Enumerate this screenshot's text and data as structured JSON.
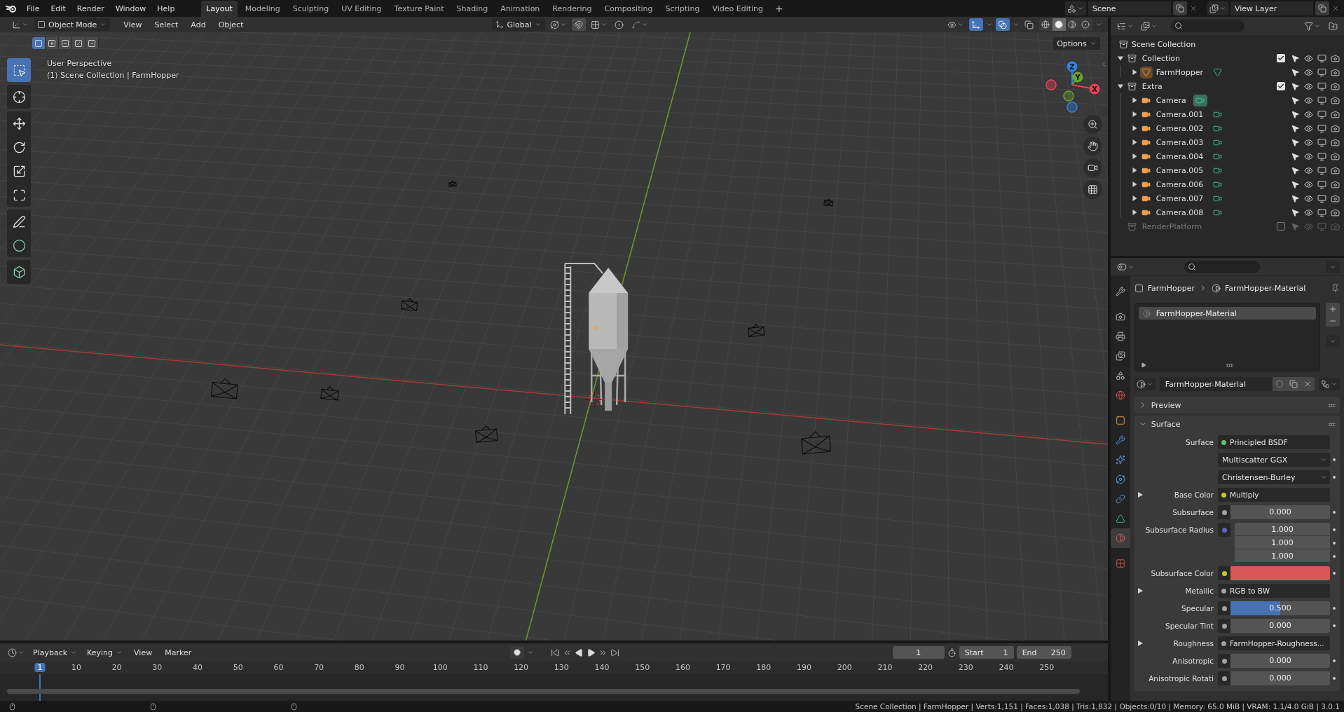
{
  "topbar": {
    "menus": [
      "File",
      "Edit",
      "Render",
      "Window",
      "Help"
    ],
    "workspaces": [
      {
        "label": "Layout",
        "selected": true
      },
      {
        "label": "Modeling",
        "selected": false
      },
      {
        "label": "Sculpting",
        "selected": false
      },
      {
        "label": "UV Editing",
        "selected": false
      },
      {
        "label": "Texture Paint",
        "selected": false
      },
      {
        "label": "Shading",
        "selected": false
      },
      {
        "label": "Animation",
        "selected": false
      },
      {
        "label": "Rendering",
        "selected": false
      },
      {
        "label": "Compositing",
        "selected": false
      },
      {
        "label": "Scripting",
        "selected": false
      },
      {
        "label": "Video Editing",
        "selected": false
      }
    ],
    "add_workspace": "+",
    "scene": "Scene",
    "view_layer": "View Layer"
  },
  "viewport": {
    "mode": "Object Mode",
    "menus": [
      "View",
      "Select",
      "Add",
      "Object"
    ],
    "orientation": "Global",
    "gizmos_on": true,
    "overlays_on": true,
    "xray_on": false,
    "options": "Options",
    "shading": [
      {
        "kind": "wireframe",
        "selected": false
      },
      {
        "kind": "solid",
        "selected": true
      },
      {
        "kind": "material",
        "selected": false
      },
      {
        "kind": "rendered",
        "selected": false
      }
    ],
    "select_modes": [
      {
        "kind": "set",
        "selected": true
      },
      {
        "kind": "extend",
        "selected": false
      },
      {
        "kind": "subtract",
        "selected": false
      },
      {
        "kind": "invert",
        "selected": false
      },
      {
        "kind": "intersect",
        "selected": false
      }
    ],
    "tool_groups": [
      {
        "tools": [
          {
            "kind": "select",
            "selected": true
          }
        ]
      },
      {
        "tools": [
          {
            "kind": "cursor",
            "selected": false
          }
        ]
      },
      {
        "tools": [
          {
            "kind": "move",
            "selected": false
          },
          {
            "kind": "rotate",
            "selected": false
          },
          {
            "kind": "scale",
            "selected": false
          },
          {
            "kind": "transform",
            "selected": false
          }
        ]
      },
      {
        "tools": [
          {
            "kind": "annotate",
            "selected": false
          },
          {
            "kind": "measure",
            "selected": false
          }
        ]
      },
      {
        "tools": [
          {
            "kind": "add_cube",
            "selected": false
          }
        ]
      }
    ],
    "info": [
      "User Perspective",
      "(1) Scene Collection | FarmHopper"
    ],
    "gizmo_axes": [
      {
        "label": "Z"
      },
      {
        "label": "Y"
      },
      {
        "label": "X"
      }
    ]
  },
  "outliner": {
    "root": {
      "name": "Scene Collection",
      "children": [
        {
          "name": "Collection",
          "kind": "collection",
          "expanded": true,
          "checked": true,
          "children": [
            {
              "name": "FarmHopper",
              "kind": "mesh",
              "expanded": false,
              "active": true,
              "data_active": false
            }
          ]
        },
        {
          "name": "Extra",
          "kind": "collection",
          "expanded": true,
          "checked": true,
          "children": [
            {
              "name": "Camera",
              "kind": "camera",
              "expanded": false,
              "active": false,
              "data_active": true
            },
            {
              "name": "Camera.001",
              "kind": "camera",
              "expanded": false,
              "active": false,
              "data_active": false
            },
            {
              "name": "Camera.002",
              "kind": "camera",
              "expanded": false,
              "active": false,
              "data_active": false
            },
            {
              "name": "Camera.003",
              "kind": "camera",
              "expanded": false,
              "active": false,
              "data_active": false
            },
            {
              "name": "Camera.004",
              "kind": "camera",
              "expanded": false,
              "active": false,
              "data_active": false
            },
            {
              "name": "Camera.005",
              "kind": "camera",
              "expanded": false,
              "active": false,
              "data_active": false
            },
            {
              "name": "Camera.006",
              "kind": "camera",
              "expanded": false,
              "active": false,
              "data_active": false
            },
            {
              "name": "Camera.007",
              "kind": "camera",
              "expanded": false,
              "active": false,
              "data_active": false
            },
            {
              "name": "Camera.008",
              "kind": "camera",
              "expanded": false,
              "active": false,
              "data_active": false
            }
          ]
        },
        {
          "name": "RenderPlatform",
          "kind": "collection",
          "checked": false
        }
      ]
    }
  },
  "properties": {
    "tab_groups": [
      {
        "tabs": [
          {
            "kind": "tool",
            "selected": false
          }
        ]
      },
      {
        "tabs": [
          {
            "kind": "render",
            "selected": false
          },
          {
            "kind": "output",
            "selected": false
          },
          {
            "kind": "view_layer",
            "selected": false
          },
          {
            "kind": "scene",
            "selected": false
          },
          {
            "kind": "world",
            "selected": false
          }
        ]
      },
      {
        "tabs": [
          {
            "kind": "object",
            "selected": false
          },
          {
            "kind": "modifiers",
            "selected": false
          },
          {
            "kind": "particles",
            "selected": false
          },
          {
            "kind": "physics",
            "selected": false
          },
          {
            "kind": "constraints",
            "selected": false
          },
          {
            "kind": "data",
            "selected": false
          },
          {
            "kind": "material",
            "selected": true
          }
        ]
      },
      {
        "tabs": [
          {
            "kind": "texture",
            "selected": false
          }
        ]
      }
    ],
    "breadcrumb": [
      "FarmHopper",
      "FarmHopper-Material"
    ],
    "slots": [
      {
        "name": "FarmHopper-Material",
        "selected": true
      }
    ],
    "material": "FarmHopper-Material",
    "panels": [
      {
        "title": "Preview",
        "expanded": false
      },
      {
        "title": "Surface",
        "expanded": true,
        "rows": [
          {
            "kind": "link",
            "label": "Surface",
            "value": "Principled BSDF",
            "socket": {
              "color": "#5fc45f"
            },
            "expandable": false
          },
          {
            "kind": "enum",
            "value": "Multiscatter GGX",
            "expandable": false
          },
          {
            "kind": "enum",
            "value": "Christensen-Burley",
            "expandable": false
          },
          {
            "kind": "link",
            "label": "Base Color",
            "value": "Multiply",
            "socket": {
              "color": "#c7c729"
            },
            "expandable": true
          },
          {
            "kind": "number",
            "label": "Subsurface",
            "value": "0.000",
            "socket": {
              "color": "#a1a1a1"
            },
            "expandable": false
          },
          {
            "kind": "vector",
            "label": "Subsurface Radius",
            "values": [
              "1.000",
              "1.000",
              "1.000"
            ],
            "socket": {
              "color": "#6363c7"
            },
            "expandable": false
          },
          {
            "kind": "color",
            "label": "Subsurface Color",
            "color": "#d95757",
            "socket": {
              "color": "#c7c729"
            },
            "expandable": false
          },
          {
            "kind": "link",
            "label": "Metallic",
            "value": "RGB to BW",
            "socket": {
              "color": "#a1a1a1"
            },
            "expandable": true
          },
          {
            "kind": "number",
            "label": "Specular",
            "value": "0.500",
            "level": 0.5,
            "socket": {
              "color": "#a1a1a1"
            },
            "expandable": false
          },
          {
            "kind": "number",
            "label": "Specular Tint",
            "value": "0.000",
            "socket": {
              "color": "#a1a1a1"
            },
            "expandable": false
          },
          {
            "kind": "link",
            "label": "Roughness",
            "value": "FarmHopper-Roughness...",
            "socket": {
              "color": "#a1a1a1"
            },
            "expandable": true
          },
          {
            "kind": "number",
            "label": "Anisotropic",
            "value": "0.000",
            "socket": {
              "color": "#a1a1a1"
            },
            "expandable": false
          },
          {
            "kind": "number",
            "label": "Anisotropic Rotati",
            "value": "0.000",
            "socket": {
              "color": "#a1a1a1"
            },
            "expandable": false
          }
        ]
      }
    ]
  },
  "timeline": {
    "menus": [
      {
        "label": "Playback",
        "dropdown": true
      },
      {
        "label": "Keying",
        "dropdown": true
      },
      {
        "label": "View",
        "dropdown": false
      },
      {
        "label": "Marker",
        "dropdown": false
      }
    ],
    "current_frame": "1",
    "start_label": "Start",
    "start": "1",
    "end_label": "End",
    "end": "250",
    "ruler": [
      {
        "label": "1",
        "selected": true
      },
      {
        "label": "10",
        "selected": false
      },
      {
        "label": "20",
        "selected": false
      },
      {
        "label": "30",
        "selected": false
      },
      {
        "label": "40",
        "selected": false
      },
      {
        "label": "50",
        "selected": false
      },
      {
        "label": "60",
        "selected": false
      },
      {
        "label": "70",
        "selected": false
      },
      {
        "label": "80",
        "selected": false
      },
      {
        "label": "90",
        "selected": false
      },
      {
        "label": "100",
        "selected": false
      },
      {
        "label": "110",
        "selected": false
      },
      {
        "label": "120",
        "selected": false
      },
      {
        "label": "130",
        "selected": false
      },
      {
        "label": "140",
        "selected": false
      },
      {
        "label": "150",
        "selected": false
      },
      {
        "label": "160",
        "selected": false
      },
      {
        "label": "170",
        "selected": false
      },
      {
        "label": "180",
        "selected": false
      },
      {
        "label": "190",
        "selected": false
      },
      {
        "label": "200",
        "selected": false
      },
      {
        "label": "210",
        "selected": false
      },
      {
        "label": "220",
        "selected": false
      },
      {
        "label": "230",
        "selected": false
      },
      {
        "label": "240",
        "selected": false
      },
      {
        "label": "250",
        "selected": false
      }
    ]
  },
  "status": "Scene Collection | FarmHopper | Verts:1,151 | Faces:1,038 | Tris:1,832 | Objects:0/10 | Memory: 65.0 MiB | VRAM: 1.1/4.0 GiB | 3.0.1"
}
